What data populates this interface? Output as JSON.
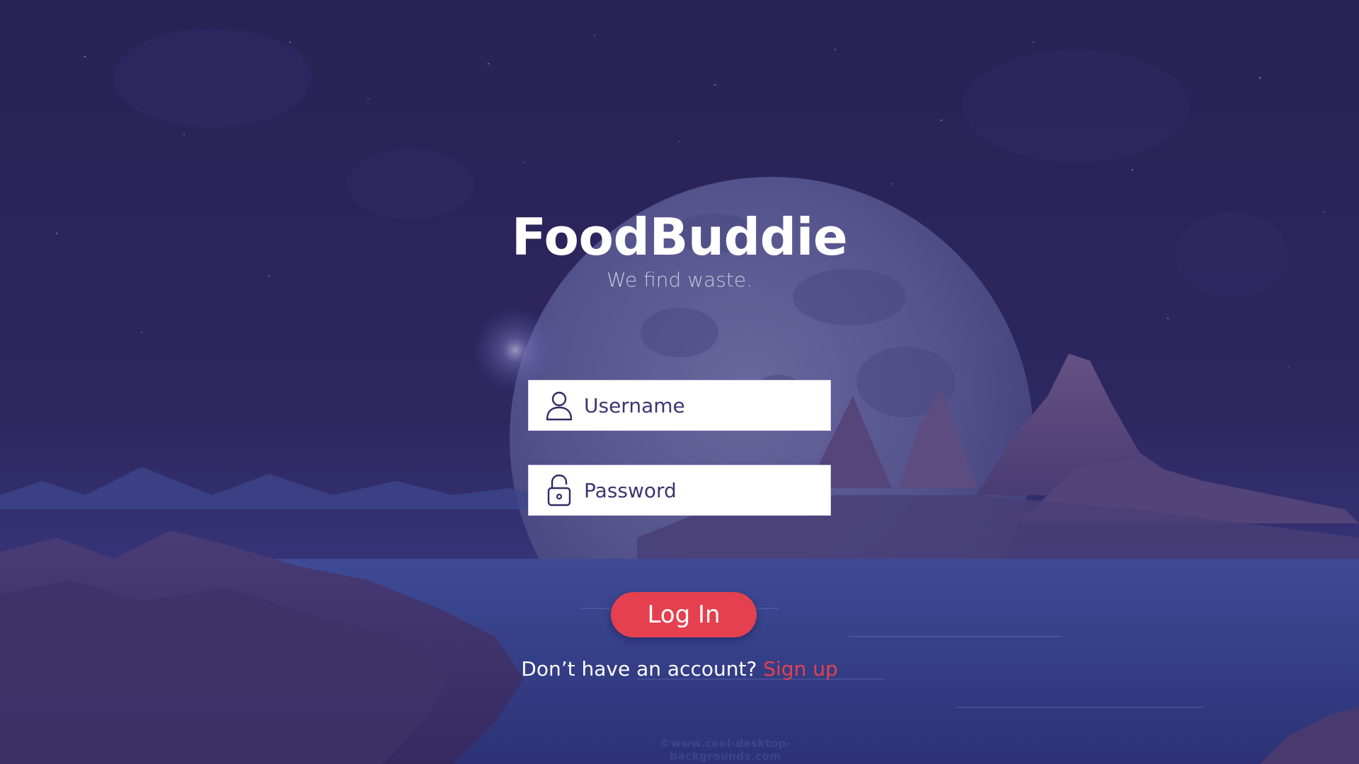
{
  "app": {
    "title": "FoodBuddie",
    "tagline": "We find waste."
  },
  "form": {
    "username": {
      "placeholder": "Username",
      "value": "",
      "icon": "user-icon"
    },
    "password": {
      "placeholder": "Password",
      "value": "",
      "icon": "lock-icon"
    },
    "login_label": "Log In"
  },
  "signup": {
    "prompt": "Don’t have an account?",
    "link_label": "Sign up"
  },
  "watermark": "©www.cool-desktop-backgrounds.com",
  "colors": {
    "accent": "#e5404f",
    "background_tint": "#2c275e",
    "input_text": "#2f2a63",
    "title": "#ffffff"
  }
}
